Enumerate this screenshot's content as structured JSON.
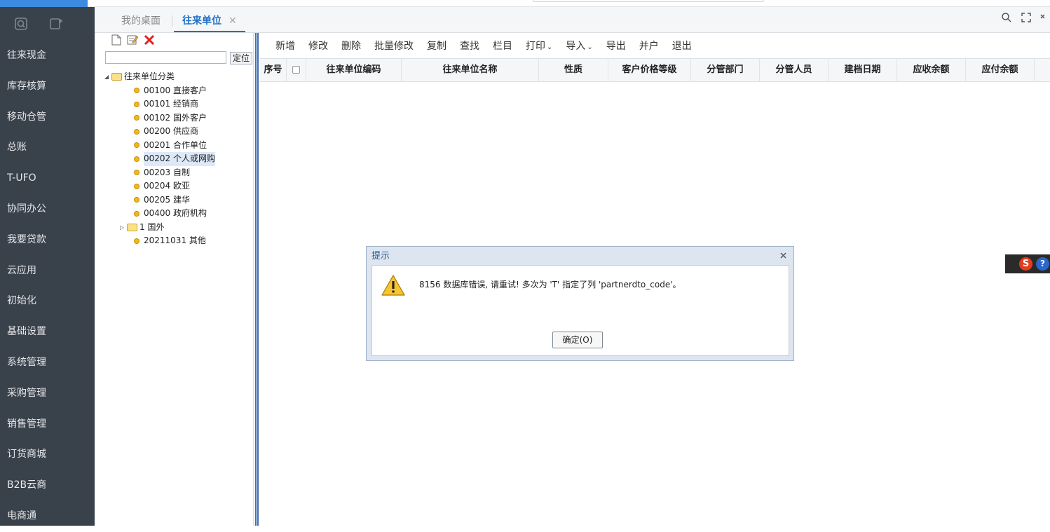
{
  "sidebar": {
    "items": [
      {
        "label": "往来现金"
      },
      {
        "label": "库存核算"
      },
      {
        "label": "移动仓管"
      },
      {
        "label": "总账"
      },
      {
        "label": "T-UFO"
      },
      {
        "label": "协同办公"
      },
      {
        "label": "我要贷款"
      },
      {
        "label": "云应用"
      },
      {
        "label": "初始化"
      },
      {
        "label": "基础设置"
      },
      {
        "label": "系统管理"
      },
      {
        "label": "采购管理"
      },
      {
        "label": "销售管理"
      },
      {
        "label": "订货商城"
      },
      {
        "label": "B2B云商"
      },
      {
        "label": "电商通"
      }
    ]
  },
  "tabs": {
    "home": "我的桌面",
    "active": "往来单位",
    "close": "✕"
  },
  "left_panel": {
    "locate_label": "定位",
    "search_value": "",
    "tree": {
      "root": "往来单位分类",
      "children": [
        {
          "label": "00100 直接客户"
        },
        {
          "label": "00101 经销商"
        },
        {
          "label": "00102 国外客户"
        },
        {
          "label": "00200 供应商"
        },
        {
          "label": "00201 合作单位"
        },
        {
          "label": "00202 个人或网购"
        },
        {
          "label": "00203 自制"
        },
        {
          "label": "00204 欧亚"
        },
        {
          "label": "00205 建华"
        },
        {
          "label": "00400 政府机构"
        }
      ],
      "folder_child": "1 国外",
      "last_child": "20211031 其他"
    }
  },
  "toolbar": {
    "add": "新增",
    "edit": "修改",
    "delete": "删除",
    "batch_edit": "批量修改",
    "copy": "复制",
    "find": "查找",
    "columns": "栏目",
    "print": "打印",
    "import": "导入",
    "export": "导出",
    "merge": "并户",
    "exit": "退出"
  },
  "grid": {
    "columns": [
      "序号",
      "往来单位编码",
      "往来单位名称",
      "性质",
      "客户价格等级",
      "分管部门",
      "分管人员",
      "建档日期",
      "应收余额",
      "应付余额"
    ]
  },
  "dialog": {
    "title": "提示",
    "message": "8156 数据库错误, 请重试! 多次为 'T' 指定了列 'partnerdto_code'。",
    "ok_label": "确定(O)"
  },
  "float_toolbar": {
    "s_label": "S",
    "help_label": "?"
  },
  "colors": {
    "sidebar_bg": "#39414b",
    "accent": "#1f6fc5",
    "splitter": "#3f6fb4"
  }
}
